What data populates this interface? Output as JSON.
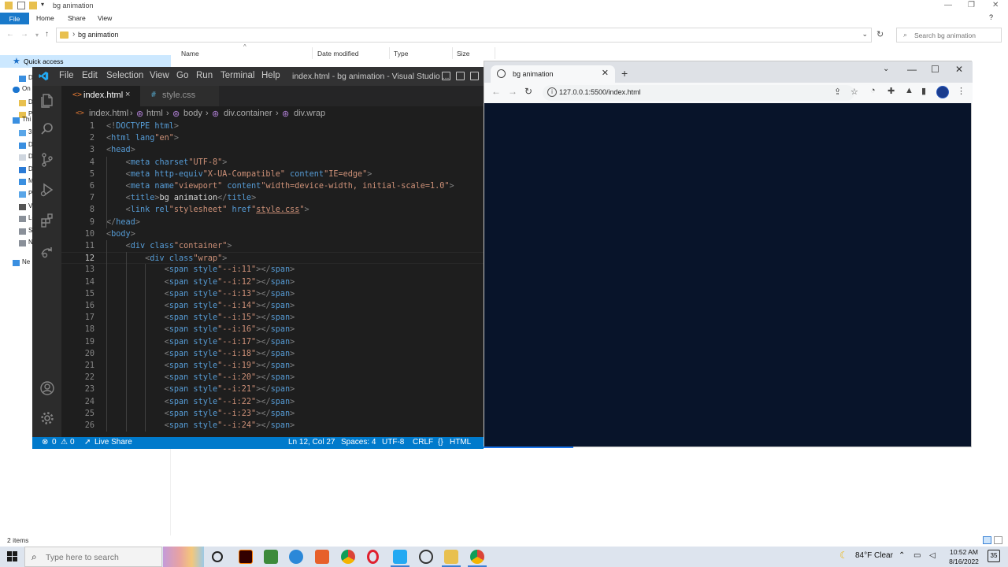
{
  "explorer": {
    "title": "bg animation",
    "ribbon": {
      "file": "File",
      "tabs": [
        "Home",
        "Share",
        "View"
      ]
    },
    "address": {
      "path": "bg animation",
      "search_placeholder": "Search bg animation"
    },
    "columns": [
      "Name",
      "Date modified",
      "Type",
      "Size"
    ],
    "nav": {
      "quick_access": "Quick access",
      "items": [
        "D",
        "D",
        "Pi",
        "On",
        "Thi",
        "3I",
        "D",
        "D",
        "D",
        "M",
        "Pi",
        "Vi",
        "Lo",
        "Sc",
        "N",
        "Ne"
      ]
    },
    "status": "2 items"
  },
  "vscode": {
    "menu": [
      "File",
      "Edit",
      "Selection",
      "View",
      "Go",
      "Run",
      "Terminal",
      "Help"
    ],
    "window_title": "index.html - bg animation - Visual Studio ...",
    "tabs": [
      {
        "icon": "<>",
        "label": "index.html",
        "close": "×"
      },
      {
        "icon": "#",
        "label": "style.css"
      }
    ],
    "breadcrumb": [
      "index.html",
      "html",
      "body",
      "div.container",
      "div.wrap"
    ],
    "active_line": 12,
    "line_numbers": [
      "1",
      "2",
      "3",
      "4",
      "5",
      "6",
      "7",
      "8",
      "9",
      "10",
      "11",
      "12",
      "13",
      "14",
      "15",
      "16",
      "17",
      "18",
      "19",
      "20",
      "21",
      "22",
      "23",
      "24",
      "25",
      "26"
    ],
    "code": [
      "<!DOCTYPE html>",
      "<html lang=\"en\">",
      "<head>",
      "    <meta charset=\"UTF-8\">",
      "    <meta http-equiv=\"X-UA-Compatible\" content=\"IE=edge\">",
      "    <meta name=\"viewport\" content=\"width=device-width, initial-scale=1.0\">",
      "    <title>bg animation</title>",
      "    <link rel=\"stylesheet\" href=\"style.css\">",
      "</head>",
      "<body>",
      "    <div class=\"container\">",
      "        <div class=\"wrap\">",
      "            <span style=\"--i:11\"></span>",
      "            <span style=\"--i:12\"></span>",
      "            <span style=\"--i:13\"></span>",
      "            <span style=\"--i:14\"></span>",
      "            <span style=\"--i:15\"></span>",
      "            <span style=\"--i:16\"></span>",
      "            <span style=\"--i:17\"></span>",
      "            <span style=\"--i:18\"></span>",
      "            <span style=\"--i:19\"></span>",
      "            <span style=\"--i:20\"></span>",
      "            <span style=\"--i:21\"></span>",
      "            <span style=\"--i:22\"></span>",
      "            <span style=\"--i:23\"></span>",
      "            <span style=\"--i:24\"></span>"
    ],
    "status": {
      "errors": "0",
      "warnings": "0",
      "live_share": "Live Share",
      "position": "Ln 12, Col 27",
      "spaces": "Spaces: 4",
      "encoding": "UTF-8",
      "eol": "CRLF",
      "language": "HTML"
    }
  },
  "chrome": {
    "tab_title": "bg animation",
    "url": "127.0.0.1:5500/index.html",
    "page_bg": "#08142a"
  },
  "taskbar": {
    "search_placeholder": "Type here to search",
    "weather": "84°F  Clear",
    "time": "10:52 AM",
    "date": "8/16/2022",
    "notifications": "35"
  },
  "colors": {
    "vscode_bg": "#1e1e1e",
    "vscode_status": "#007acc",
    "explorer_file_tab": "#1979ca",
    "chrome_accent": "#1a73e8"
  }
}
